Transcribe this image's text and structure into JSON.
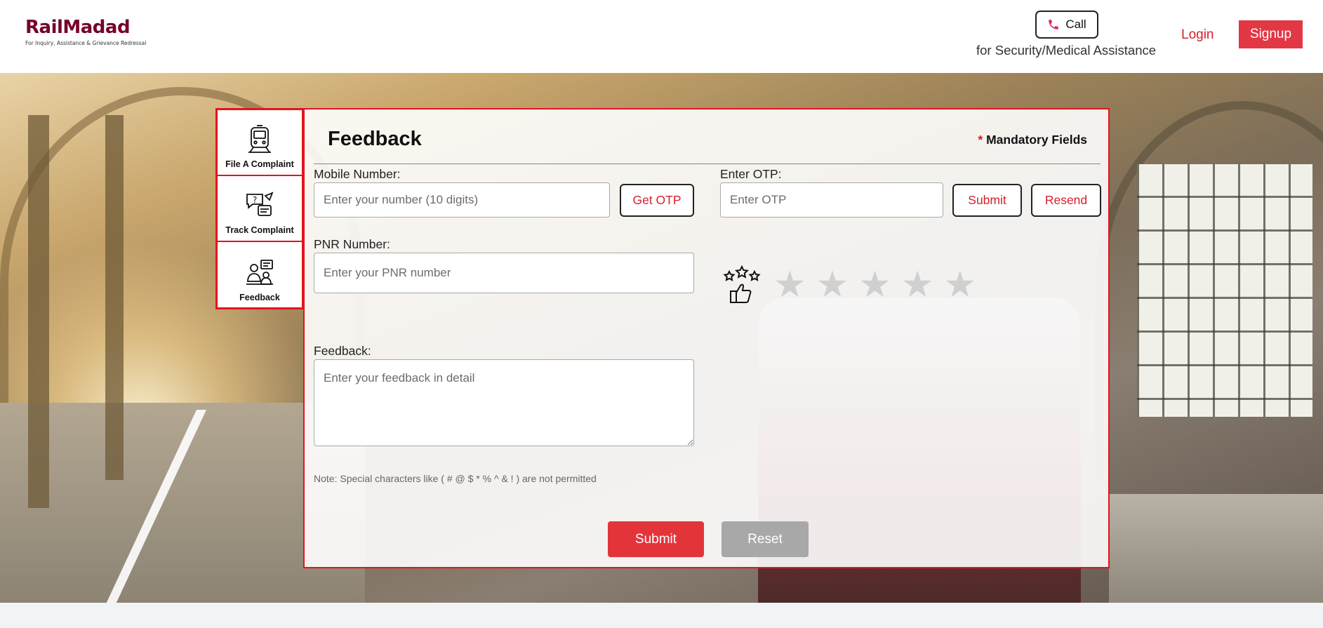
{
  "header": {
    "logo_title": "RailMadad",
    "logo_subtitle": "For Inquiry, Assistance & Grievance Redressal",
    "call_label": "Call",
    "assist_text": "for Security/Medical Assistance",
    "login_label": "Login",
    "signup_label": "Signup"
  },
  "side_menu": {
    "items": [
      {
        "label": "File A Complaint",
        "icon": "train-icon"
      },
      {
        "label": "Track Complaint",
        "icon": "track-icon"
      },
      {
        "label": "Feedback",
        "icon": "feedback-icon"
      }
    ]
  },
  "form": {
    "title": "Feedback",
    "mandatory_star": "*",
    "mandatory_text": "Mandatory Fields",
    "mobile": {
      "label": "Mobile Number:",
      "placeholder": "Enter your number (10 digits)",
      "get_otp_label": "Get OTP"
    },
    "otp": {
      "label": "Enter OTP:",
      "placeholder": "Enter OTP",
      "submit_label": "Submit",
      "resend_label": "Resend"
    },
    "pnr": {
      "label": "PNR Number:",
      "placeholder": "Enter your PNR number"
    },
    "rating": {
      "icon": "rating-thumbs-up-icon",
      "stars": 5,
      "selected": 0
    },
    "feedback": {
      "label": "Feedback:",
      "placeholder": "Enter your feedback in detail"
    },
    "note": "Note: Special characters like ( # @ $ * % ^ & ! ) are not permitted",
    "submit_label": "Submit",
    "reset_label": "Reset"
  },
  "colors": {
    "brand": "#75002b",
    "accent": "#e3141e",
    "signup_bg": "#e23744",
    "reset_bg": "#a8a8a8"
  }
}
